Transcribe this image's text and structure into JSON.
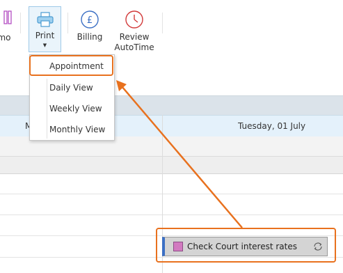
{
  "ribbon": {
    "memo_label": "mo",
    "print_label": "Print",
    "billing_label": "Billing",
    "review_line1": "Review",
    "review_line2": "AutoTime"
  },
  "print_menu": {
    "items": [
      "Appointment",
      "Daily View",
      "Weekly View",
      "Monthly View"
    ]
  },
  "calendar": {
    "left_header_fragment": "M",
    "date_header": "Tuesday, 01 July"
  },
  "appointment": {
    "title": "Check Court interest rates",
    "category_color": "#d27ac0"
  },
  "annotation": {
    "highlight_color": "#e8711e"
  }
}
